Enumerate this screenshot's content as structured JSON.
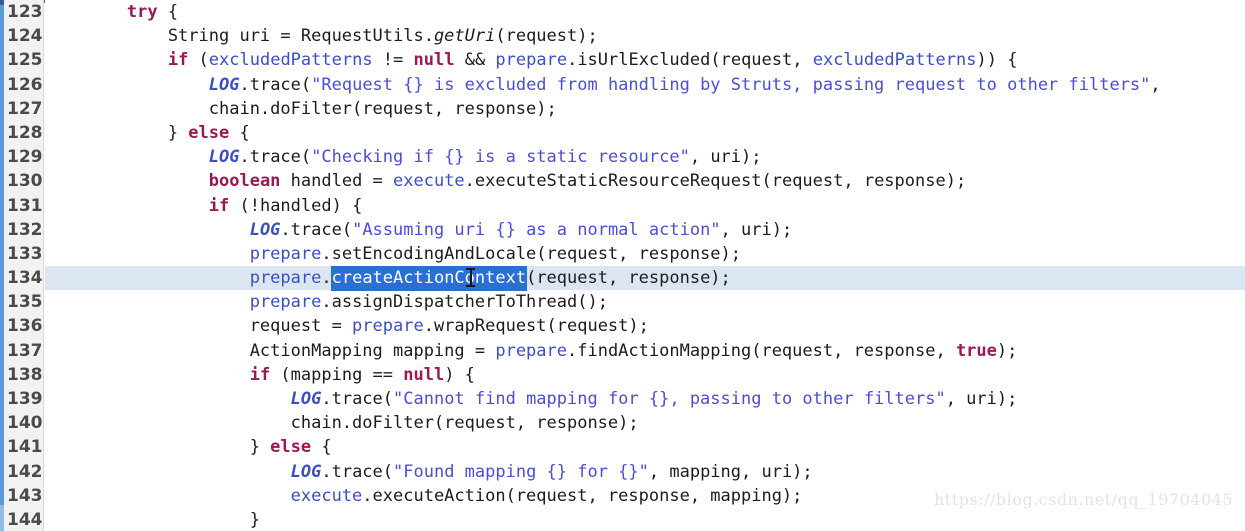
{
  "editor": {
    "language": "java",
    "first_line_number": 123,
    "last_line_number": 144,
    "highlighted_line": 134,
    "selection_text": "createActionContext",
    "colors": {
      "keyword": "#9b1854",
      "string": "#4b4ddb",
      "field": "#3b4ec8",
      "plain": "#1c1c1c",
      "selection_bg": "#2b6fd4",
      "selection_fg": "#ffffff",
      "current_line_bg": "#dce6f3",
      "gutter_bg": "#f2f2f2",
      "gutter_accent": "#5b9bd5",
      "background": "#ffffff"
    }
  },
  "gutter": {
    "line_numbers": [
      "123",
      "124",
      "125",
      "126",
      "127",
      "128",
      "129",
      "130",
      "131",
      "132",
      "133",
      "134",
      "135",
      "136",
      "137",
      "138",
      "139",
      "140",
      "141",
      "142",
      "143",
      "144"
    ]
  },
  "code": {
    "lines": [
      {
        "number": "123",
        "plain": "        try {",
        "tokens": [
          {
            "t": "        ",
            "c": "pln"
          },
          {
            "t": "try",
            "c": "kw"
          },
          {
            "t": " {",
            "c": "pln"
          }
        ]
      },
      {
        "number": "124",
        "plain": "            String uri = RequestUtils.getUri(request);",
        "tokens": [
          {
            "t": "            String uri = RequestUtils.",
            "c": "pln"
          },
          {
            "t": "getUri",
            "c": "mth"
          },
          {
            "t": "(request);",
            "c": "pln"
          }
        ]
      },
      {
        "number": "125",
        "plain": "            if (excludedPatterns != null && prepare.isUrlExcluded(request, excludedPatterns)) {",
        "tokens": [
          {
            "t": "            ",
            "c": "pln"
          },
          {
            "t": "if",
            "c": "kw"
          },
          {
            "t": " (",
            "c": "pln"
          },
          {
            "t": "excludedPatterns",
            "c": "var"
          },
          {
            "t": " != ",
            "c": "pln"
          },
          {
            "t": "null",
            "c": "kw"
          },
          {
            "t": " && ",
            "c": "pln"
          },
          {
            "t": "prepare",
            "c": "var"
          },
          {
            "t": ".isUrlExcluded(request, ",
            "c": "pln"
          },
          {
            "t": "excludedPatterns",
            "c": "var"
          },
          {
            "t": ")) {",
            "c": "pln"
          }
        ]
      },
      {
        "number": "126",
        "plain": "                LOG.trace(\"Request {} is excluded from handling by Struts, passing request to other filters\",",
        "tokens": [
          {
            "t": "                ",
            "c": "pln"
          },
          {
            "t": "LOG",
            "c": "stat"
          },
          {
            "t": ".trace(",
            "c": "pln"
          },
          {
            "t": "\"Request {} is excluded from handling by Struts, passing request to other filters\"",
            "c": "str"
          },
          {
            "t": ",",
            "c": "pln"
          }
        ]
      },
      {
        "number": "127",
        "plain": "                chain.doFilter(request, response);",
        "tokens": [
          {
            "t": "                chain.doFilter(request, response);",
            "c": "pln"
          }
        ]
      },
      {
        "number": "128",
        "plain": "            } else {",
        "tokens": [
          {
            "t": "            } ",
            "c": "pln"
          },
          {
            "t": "else",
            "c": "kw"
          },
          {
            "t": " {",
            "c": "pln"
          }
        ]
      },
      {
        "number": "129",
        "plain": "                LOG.trace(\"Checking if {} is a static resource\", uri);",
        "tokens": [
          {
            "t": "                ",
            "c": "pln"
          },
          {
            "t": "LOG",
            "c": "stat"
          },
          {
            "t": ".trace(",
            "c": "pln"
          },
          {
            "t": "\"Checking if {} is a static resource\"",
            "c": "str"
          },
          {
            "t": ", uri);",
            "c": "pln"
          }
        ]
      },
      {
        "number": "130",
        "plain": "                boolean handled = execute.executeStaticResourceRequest(request, response);",
        "tokens": [
          {
            "t": "                ",
            "c": "pln"
          },
          {
            "t": "boolean",
            "c": "kw"
          },
          {
            "t": " handled = ",
            "c": "pln"
          },
          {
            "t": "execute",
            "c": "var"
          },
          {
            "t": ".executeStaticResourceRequest(request, response);",
            "c": "pln"
          }
        ]
      },
      {
        "number": "131",
        "plain": "                if (!handled) {",
        "tokens": [
          {
            "t": "                ",
            "c": "pln"
          },
          {
            "t": "if",
            "c": "kw"
          },
          {
            "t": " (!handled) {",
            "c": "pln"
          }
        ]
      },
      {
        "number": "132",
        "plain": "                    LOG.trace(\"Assuming uri {} as a normal action\", uri);",
        "tokens": [
          {
            "t": "                    ",
            "c": "pln"
          },
          {
            "t": "LOG",
            "c": "stat"
          },
          {
            "t": ".trace(",
            "c": "pln"
          },
          {
            "t": "\"Assuming uri {} as a normal action\"",
            "c": "str"
          },
          {
            "t": ", uri);",
            "c": "pln"
          }
        ]
      },
      {
        "number": "133",
        "plain": "                    prepare.setEncodingAndLocale(request, response);",
        "tokens": [
          {
            "t": "                    ",
            "c": "pln"
          },
          {
            "t": "prepare",
            "c": "var"
          },
          {
            "t": ".setEncodingAndLocale(request, response);",
            "c": "pln"
          }
        ]
      },
      {
        "number": "134",
        "highlight": true,
        "plain": "                    prepare.createActionContext(request, response);",
        "tokens": [
          {
            "t": "                    ",
            "c": "pln"
          },
          {
            "t": "prepare",
            "c": "var"
          },
          {
            "t": ".",
            "c": "pln"
          },
          {
            "t": "createActionContext",
            "c": "sel"
          },
          {
            "t": "(request, response);",
            "c": "pln"
          }
        ]
      },
      {
        "number": "135",
        "plain": "                    prepare.assignDispatcherToThread();",
        "tokens": [
          {
            "t": "                    ",
            "c": "pln"
          },
          {
            "t": "prepare",
            "c": "var"
          },
          {
            "t": ".assignDispatcherToThread();",
            "c": "pln"
          }
        ]
      },
      {
        "number": "136",
        "plain": "                    request = prepare.wrapRequest(request);",
        "tokens": [
          {
            "t": "                    request = ",
            "c": "pln"
          },
          {
            "t": "prepare",
            "c": "var"
          },
          {
            "t": ".wrapRequest(request);",
            "c": "pln"
          }
        ]
      },
      {
        "number": "137",
        "plain": "                    ActionMapping mapping = prepare.findActionMapping(request, response, true);",
        "tokens": [
          {
            "t": "                    ActionMapping mapping = ",
            "c": "pln"
          },
          {
            "t": "prepare",
            "c": "var"
          },
          {
            "t": ".findActionMapping(request, response, ",
            "c": "pln"
          },
          {
            "t": "true",
            "c": "kw"
          },
          {
            "t": ");",
            "c": "pln"
          }
        ]
      },
      {
        "number": "138",
        "plain": "                    if (mapping == null) {",
        "tokens": [
          {
            "t": "                    ",
            "c": "pln"
          },
          {
            "t": "if",
            "c": "kw"
          },
          {
            "t": " (mapping == ",
            "c": "pln"
          },
          {
            "t": "null",
            "c": "kw"
          },
          {
            "t": ") {",
            "c": "pln"
          }
        ]
      },
      {
        "number": "139",
        "plain": "                        LOG.trace(\"Cannot find mapping for {}, passing to other filters\", uri);",
        "tokens": [
          {
            "t": "                        ",
            "c": "pln"
          },
          {
            "t": "LOG",
            "c": "stat"
          },
          {
            "t": ".trace(",
            "c": "pln"
          },
          {
            "t": "\"Cannot find mapping for {}, passing to other filters\"",
            "c": "str"
          },
          {
            "t": ", uri);",
            "c": "pln"
          }
        ]
      },
      {
        "number": "140",
        "plain": "                        chain.doFilter(request, response);",
        "tokens": [
          {
            "t": "                        chain.doFilter(request, response);",
            "c": "pln"
          }
        ]
      },
      {
        "number": "141",
        "plain": "                    } else {",
        "tokens": [
          {
            "t": "                    } ",
            "c": "pln"
          },
          {
            "t": "else",
            "c": "kw"
          },
          {
            "t": " {",
            "c": "pln"
          }
        ]
      },
      {
        "number": "142",
        "plain": "                        LOG.trace(\"Found mapping {} for {}\", mapping, uri);",
        "tokens": [
          {
            "t": "                        ",
            "c": "pln"
          },
          {
            "t": "LOG",
            "c": "stat"
          },
          {
            "t": ".trace(",
            "c": "pln"
          },
          {
            "t": "\"Found mapping {} for {}\"",
            "c": "str"
          },
          {
            "t": ", mapping, uri);",
            "c": "pln"
          }
        ]
      },
      {
        "number": "143",
        "plain": "                        execute.executeAction(request, response, mapping);",
        "tokens": [
          {
            "t": "                        ",
            "c": "pln"
          },
          {
            "t": "execute",
            "c": "var"
          },
          {
            "t": ".executeAction(request, response, mapping);",
            "c": "pln"
          }
        ]
      },
      {
        "number": "144",
        "plain": "                    }",
        "tokens": [
          {
            "t": "                    }",
            "c": "pln"
          }
        ]
      }
    ]
  },
  "watermark": {
    "text": "https://blog.csdn.net/qq_19704045"
  }
}
